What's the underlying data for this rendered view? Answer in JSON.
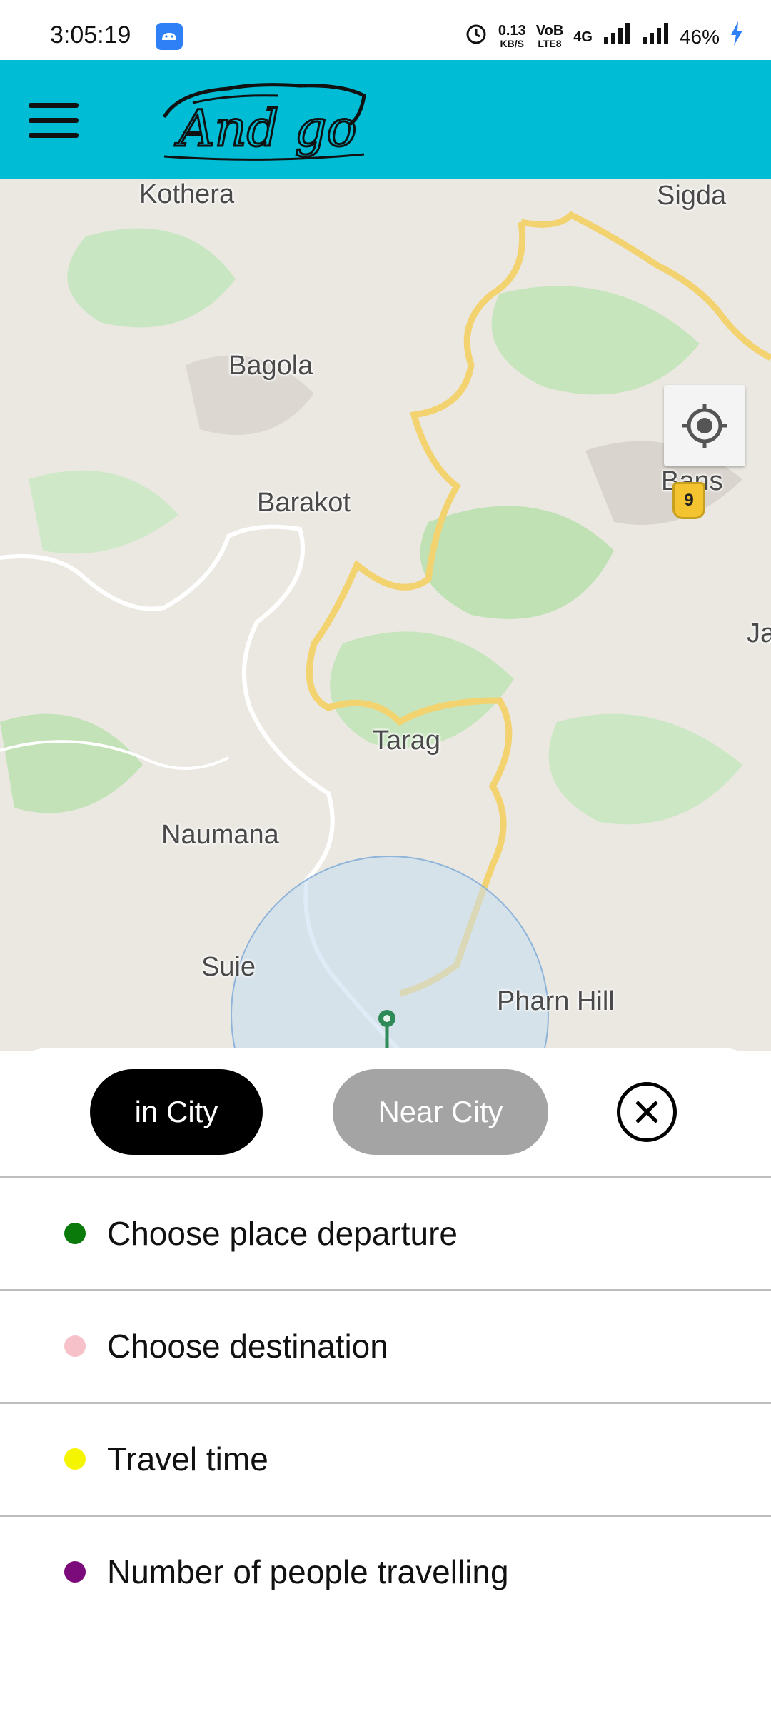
{
  "status_bar": {
    "time": "3:05:19",
    "net_speed_value": "0.13",
    "net_speed_unit": "KB/S",
    "volte_top": "VoB",
    "volte_bottom": "LTE8",
    "network": "4G",
    "battery": "46%"
  },
  "app_bar": {
    "logo_text": "And go",
    "menu_icon": "hamburger-menu-icon",
    "background": "#00bcd4"
  },
  "map": {
    "places": [
      "Kothera",
      "Sigda",
      "Bagola",
      "Barakot",
      "Bans",
      "Ja",
      "Tarag",
      "Naumana",
      "Suie",
      "Pharn Hill"
    ],
    "road_shield": "9",
    "locate_icon": "my-location-icon"
  },
  "bottom_sheet": {
    "tabs": [
      {
        "label": "in City",
        "active": true,
        "color": "#000000"
      },
      {
        "label": "Near City",
        "active": false,
        "color": "#a4a4a4"
      }
    ],
    "close_icon": "close-circle-icon",
    "options": [
      {
        "label": "Choose place departure",
        "dot_color": "#0a7a0a"
      },
      {
        "label": "Choose destination",
        "dot_color": "#f6c1c8"
      },
      {
        "label": "Travel time",
        "dot_color": "#f5f500"
      },
      {
        "label": "Number of people travelling",
        "dot_color": "#7b0a7b"
      }
    ]
  }
}
